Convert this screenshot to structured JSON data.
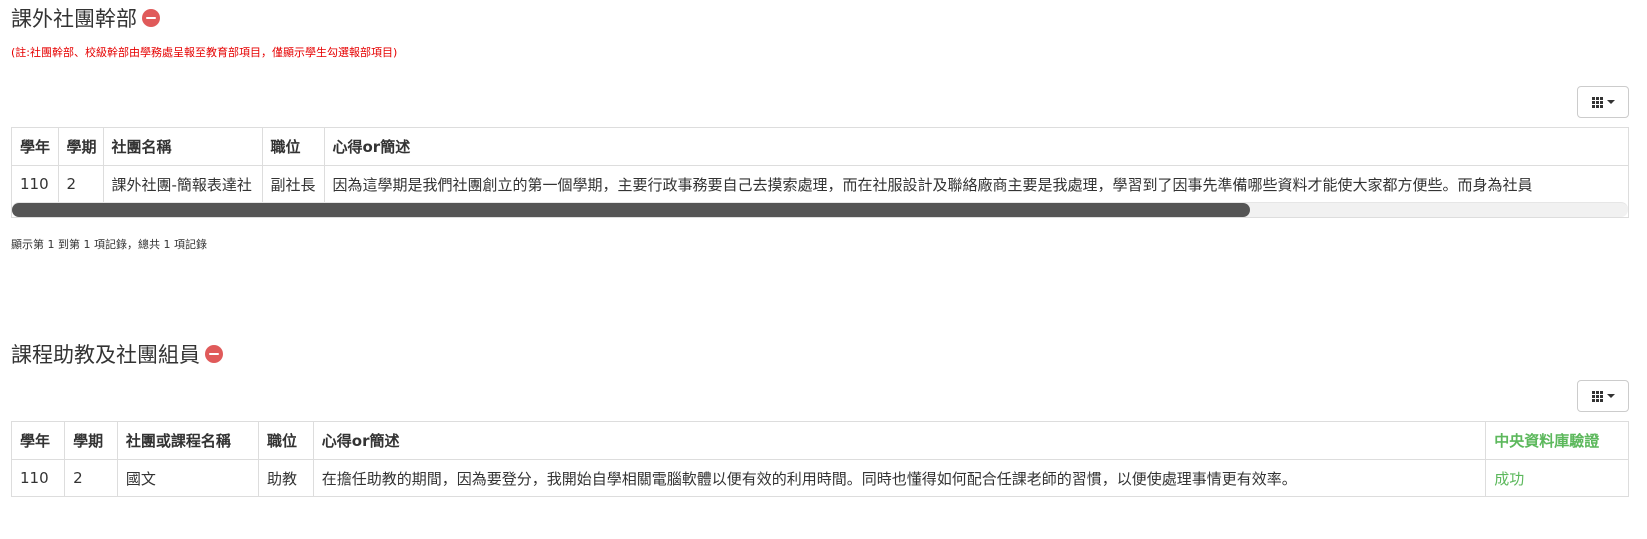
{
  "section1": {
    "title": "課外社團幹部",
    "note": "(註:社團幹部、校級幹部由學務處呈報至教育部項目，僅顯示學生勾選報部項目)",
    "columns": [
      "學年",
      "學期",
      "社團名稱",
      "職位",
      "心得or簡述"
    ],
    "rows": [
      [
        "110",
        "2",
        "課外社團-簡報表達社",
        "副社長",
        "因為這學期是我們社團創立的第一個學期，主要行政事務要自己去摸索處理，而在社服設計及聯絡廠商主要是我處理，學習到了因事先準備哪些資料才能使大家都方便些。而身為社員"
      ]
    ],
    "footer": "顯示第 1 到第 1 項記錄，總共 1 項記錄"
  },
  "section2": {
    "title": "課程助教及社團組員",
    "columns": [
      "學年",
      "學期",
      "社團或課程名稱",
      "職位",
      "心得or簡述",
      "中央資料庫驗證"
    ],
    "rows": [
      [
        "110",
        "2",
        "國文",
        "助教",
        "在擔任助教的期間，因為要登分，我開始自學相關電腦軟體以便有效的利用時間。同時也懂得如何配合任課老師的習慣，以便使處理事情更有效率。",
        "成功"
      ]
    ]
  },
  "icons": {
    "remove": "minus-circle-icon",
    "columns_toggle": "grid-icon",
    "dropdown": "caret-down-icon"
  },
  "colors": {
    "remove_icon": "#e05a5a",
    "note_text": "#e60000",
    "verify_text": "#5cb85c",
    "scroll_thumb": "#555555"
  }
}
